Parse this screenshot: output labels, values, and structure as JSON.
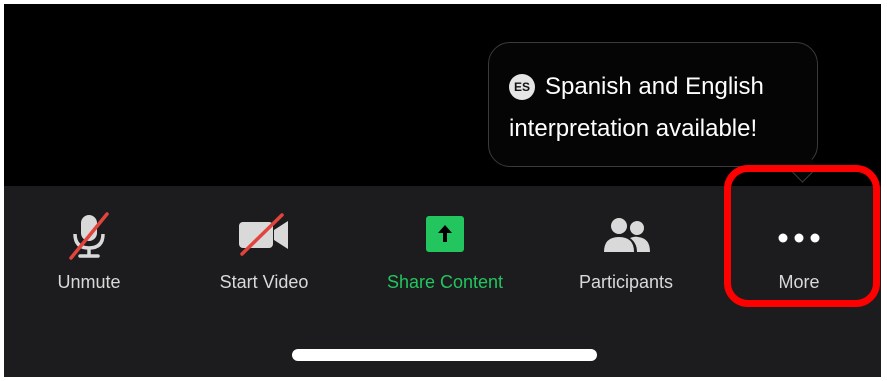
{
  "tooltip": {
    "badge": "ES",
    "line1": "Spanish and English",
    "line2": "interpretation available!"
  },
  "toolbar": {
    "unmute_label": "Unmute",
    "start_video_label": "Start Video",
    "share_label": "Share Content",
    "participants_label": "Participants",
    "more_label": "More"
  },
  "colors": {
    "background": "#000000",
    "toolbar": "#1c1c1e",
    "accent_green": "#22c55e",
    "mute_slash": "#e0443c",
    "highlight": "#ff0000"
  }
}
